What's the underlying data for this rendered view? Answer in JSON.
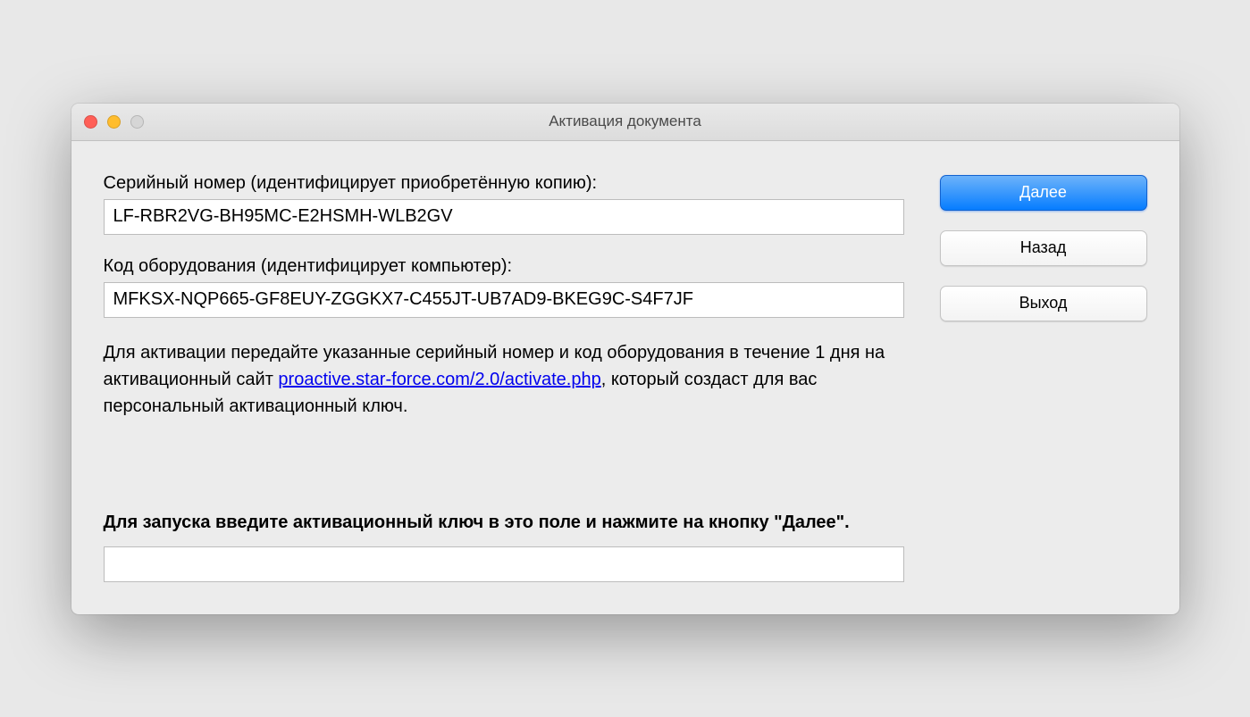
{
  "window": {
    "title": "Активация документа"
  },
  "main": {
    "serial_label": "Серийный номер (идентифицирует приобретённую копию):",
    "serial_value": "LF-RBR2VG-BH95MC-E2HSMH-WLB2GV",
    "hardware_label": "Код оборудования (идентифицирует компьютер):",
    "hardware_value": "MFKSX-NQP665-GF8EUY-ZGGKX7-C455JT-UB7AD9-BKEG9C-S4F7JF",
    "info_before_link": "Для активации передайте указанные серийный номер и код оборудования в течение 1 дня на активационный сайт ",
    "link_text": "proactive.star-force.com/2.0/activate.php",
    "info_after_link": ", который создаст для вас персональный активационный ключ.",
    "bold_instruction": "Для запуска введите активационный ключ в это поле и нажмите на кнопку \"Далее\".",
    "activation_key_value": ""
  },
  "buttons": {
    "next": "Далее",
    "back": "Назад",
    "exit": "Выход"
  }
}
